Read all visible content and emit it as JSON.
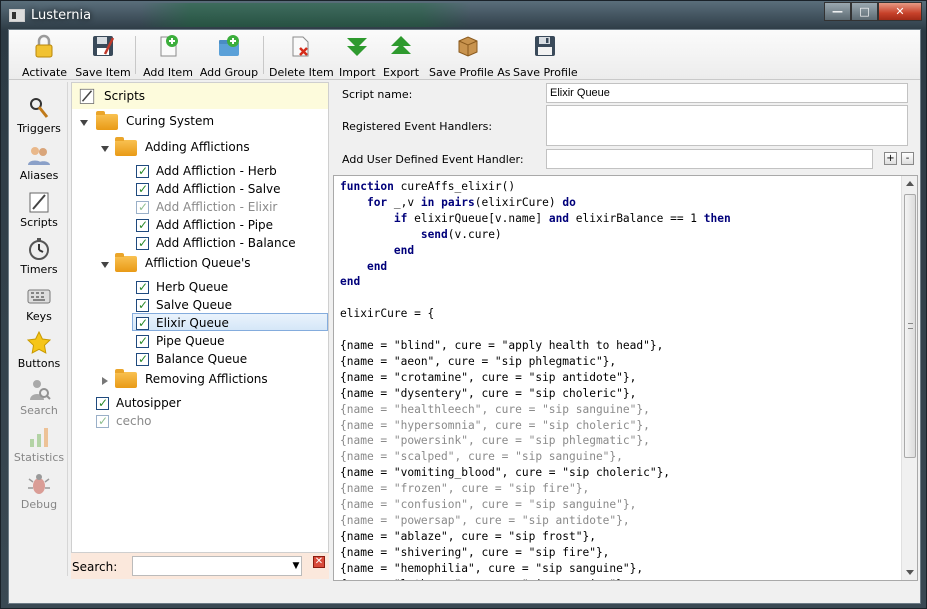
{
  "window": {
    "title": "Lusternia",
    "controls": {
      "minimize": "—",
      "maximize": "□",
      "close": "✕"
    }
  },
  "toolbar": {
    "buttons": [
      {
        "label": "Activate",
        "icon": "lock-icon"
      },
      {
        "label": "Save Item",
        "icon": "save-item-icon"
      },
      {
        "label": "Add Item",
        "icon": "add-item-icon"
      },
      {
        "label": "Add Group",
        "icon": "add-group-icon"
      },
      {
        "label": "Delete Item",
        "icon": "delete-item-icon"
      },
      {
        "label": "Import",
        "icon": "import-arrow-icon"
      },
      {
        "label": "Export",
        "icon": "export-arrow-icon"
      },
      {
        "label": "Save Profile As",
        "icon": "package-icon"
      },
      {
        "label": "Save Profile",
        "icon": "floppy-disk-icon"
      }
    ]
  },
  "sidebar": {
    "items": [
      {
        "label": "Triggers",
        "icon": "triggers-icon",
        "enabled": true
      },
      {
        "label": "Aliases",
        "icon": "aliases-icon",
        "enabled": true
      },
      {
        "label": "Scripts",
        "icon": "scripts-icon",
        "enabled": true
      },
      {
        "label": "Timers",
        "icon": "timers-icon",
        "enabled": true
      },
      {
        "label": "Keys",
        "icon": "keys-icon",
        "enabled": true
      },
      {
        "label": "Buttons",
        "icon": "star-icon",
        "enabled": true
      },
      {
        "label": "Search",
        "icon": "search-person-icon",
        "enabled": false
      },
      {
        "label": "Statistics",
        "icon": "statistics-icon",
        "enabled": false
      },
      {
        "label": "Debug",
        "icon": "bug-icon",
        "enabled": false
      }
    ]
  },
  "tree": {
    "header": "Scripts",
    "nodes": [
      {
        "label": "Curing System",
        "type": "folder",
        "expanded": true
      },
      {
        "label": "Adding Afflictions",
        "type": "folder",
        "expanded": true
      },
      {
        "label": "Add Affliction - Herb",
        "type": "item",
        "active": true
      },
      {
        "label": "Add Affliction - Salve",
        "type": "item",
        "active": true
      },
      {
        "label": "Add Affliction - Elixir",
        "type": "item",
        "active": false
      },
      {
        "label": "Add Affliction - Pipe",
        "type": "item",
        "active": true
      },
      {
        "label": "Add Affliction - Balance",
        "type": "item",
        "active": true
      },
      {
        "label": "Affliction Queue's",
        "type": "folder",
        "expanded": true
      },
      {
        "label": "Herb Queue",
        "type": "item",
        "active": true
      },
      {
        "label": "Salve Queue",
        "type": "item",
        "active": true
      },
      {
        "label": "Elixir Queue",
        "type": "item",
        "active": true,
        "selected": true
      },
      {
        "label": "Pipe Queue",
        "type": "item",
        "active": true
      },
      {
        "label": "Balance Queue",
        "type": "item",
        "active": true
      },
      {
        "label": "Removing Afflictions",
        "type": "folder",
        "expanded": false
      },
      {
        "label": "Autosipper",
        "type": "item",
        "active": true
      },
      {
        "label": "cecho",
        "type": "item",
        "active": false
      }
    ]
  },
  "search": {
    "label": "Search:",
    "value": "",
    "clear": "✕"
  },
  "properties": {
    "script_name_label": "Script name:",
    "script_name_value": "Elixir Queue",
    "event_handlers_label": "Registered Event Handlers:",
    "add_handler_label": "Add User Defined Event Handler:",
    "add_handler_value": "",
    "add_btn": "+",
    "remove_btn": "-"
  },
  "editor": {
    "lines": [
      {
        "text": "function cureAffs_elixir()",
        "dim": false
      },
      {
        "text": "    for _,v in pairs(elixirCure) do",
        "dim": false
      },
      {
        "text": "        if elixirQueue[v.name] and elixirBalance == 1 then",
        "dim": false
      },
      {
        "text": "            send(v.cure)",
        "dim": false
      },
      {
        "text": "        end",
        "dim": false
      },
      {
        "text": "    end",
        "dim": false
      },
      {
        "text": "end",
        "dim": false
      },
      {
        "text": "",
        "dim": false
      },
      {
        "text": "elixirCure = {",
        "dim": false
      },
      {
        "text": "",
        "dim": false
      },
      {
        "text": "{name = \"blind\", cure = \"apply health to head\"},",
        "dim": false
      },
      {
        "text": "{name = \"aeon\", cure = \"sip phlegmatic\"},",
        "dim": false
      },
      {
        "text": "{name = \"crotamine\", cure = \"sip antidote\"},",
        "dim": false
      },
      {
        "text": "{name = \"dysentery\", cure = \"sip choleric\"},",
        "dim": false
      },
      {
        "text": "{name = \"healthleech\", cure = \"sip sanguine\"},",
        "dim": true
      },
      {
        "text": "{name = \"hypersomnia\", cure = \"sip choleric\"},",
        "dim": true
      },
      {
        "text": "{name = \"powersink\", cure = \"sip phlegmatic\"},",
        "dim": true
      },
      {
        "text": "{name = \"scalped\", cure = \"sip sanguine\"},",
        "dim": true
      },
      {
        "text": "{name = \"vomiting_blood\", cure = \"sip choleric\"},",
        "dim": false
      },
      {
        "text": "{name = \"frozen\", cure = \"sip fire\"},",
        "dim": true
      },
      {
        "text": "{name = \"confusion\", cure = \"sip sanguine\"},",
        "dim": true
      },
      {
        "text": "{name = \"powersap\", cure = \"sip antidote\"},",
        "dim": true
      },
      {
        "text": "{name = \"ablaze\", cure = \"sip frost\"},",
        "dim": false
      },
      {
        "text": "{name = \"shivering\", cure = \"sip fire\"},",
        "dim": false
      },
      {
        "text": "{name = \"hemophilia\", cure = \"sip sanguine\"},",
        "dim": false
      },
      {
        "text": "{name = \"lethargy\", cure = \"sip sanguine\"},",
        "dim": false
      }
    ]
  },
  "colors": {
    "keyword": "#00007a",
    "selection": "#d5e7f8",
    "tree_header": "#fdfbdc",
    "search_bar": "#fbe8dc"
  }
}
